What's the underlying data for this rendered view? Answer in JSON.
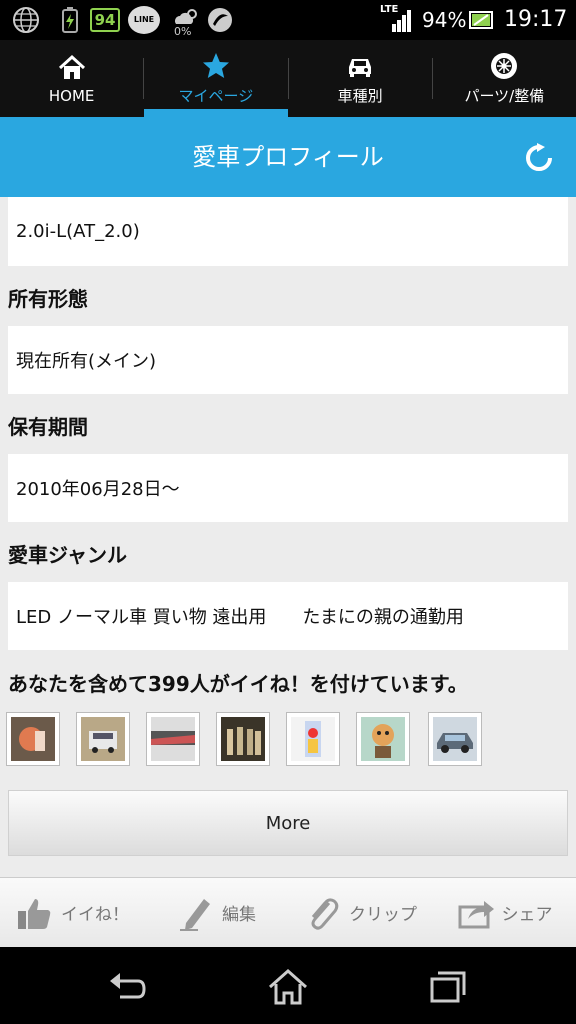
{
  "status": {
    "line_text": "LINE",
    "badge": "94",
    "weather_pct": "0%",
    "network": "LTE",
    "battery": "94%",
    "time": "19:17"
  },
  "nav": {
    "tabs": [
      {
        "label": "HOME",
        "icon": "home-icon"
      },
      {
        "label": "マイページ",
        "icon": "star-icon"
      },
      {
        "label": "車種別",
        "icon": "car-icon"
      },
      {
        "label": "パーツ/整備",
        "icon": "wheel-icon"
      }
    ],
    "active_index": 1
  },
  "header": {
    "title": "愛車プロフィール",
    "icon": "refresh-icon"
  },
  "profile": {
    "grade_value": "2.0i-L(AT_2.0)",
    "ownership_label": "所有形態",
    "ownership_value": "現在所有(メイン)",
    "period_label": "保有期間",
    "period_value": "2010年06月28日～",
    "genre_label": "愛車ジャンル",
    "genre_value": "LED ノーマル車 買い物 遠出用　　たまにの親の通勤用",
    "likes_text": "あなたを含めて399人がイイね！を付けています。"
  },
  "more_label": "More",
  "actions": [
    {
      "label": "イイね！",
      "icon": "thumbs-up-icon"
    },
    {
      "label": "編集",
      "icon": "pen-icon"
    },
    {
      "label": "クリップ",
      "icon": "paperclip-icon"
    },
    {
      "label": "シェア",
      "icon": "share-icon"
    }
  ],
  "colors": {
    "accent": "#2aa7e0",
    "nav_bg": "#111111",
    "page_bg": "#ececec"
  }
}
